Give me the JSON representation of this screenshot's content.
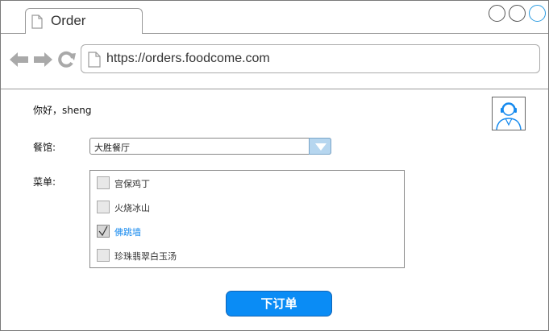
{
  "browser": {
    "tab_title": "Order",
    "url": "https://orders.foodcome.com"
  },
  "page": {
    "greeting": "你好，sheng",
    "restaurant_label": "餐馆:",
    "restaurant_selected": "大胜餐厅",
    "menu_label": "菜单:",
    "menu_items": [
      {
        "label": "宫保鸡丁",
        "checked": false
      },
      {
        "label": "火烧冰山",
        "checked": false
      },
      {
        "label": "佛跳墙",
        "checked": true
      },
      {
        "label": "珍珠翡翠白玉汤",
        "checked": false
      }
    ],
    "order_button": "下订单"
  },
  "colors": {
    "accent": "#0a8cf5",
    "selected_text": "#1589ee",
    "select_arrow_bg": "#b6d6ef"
  }
}
